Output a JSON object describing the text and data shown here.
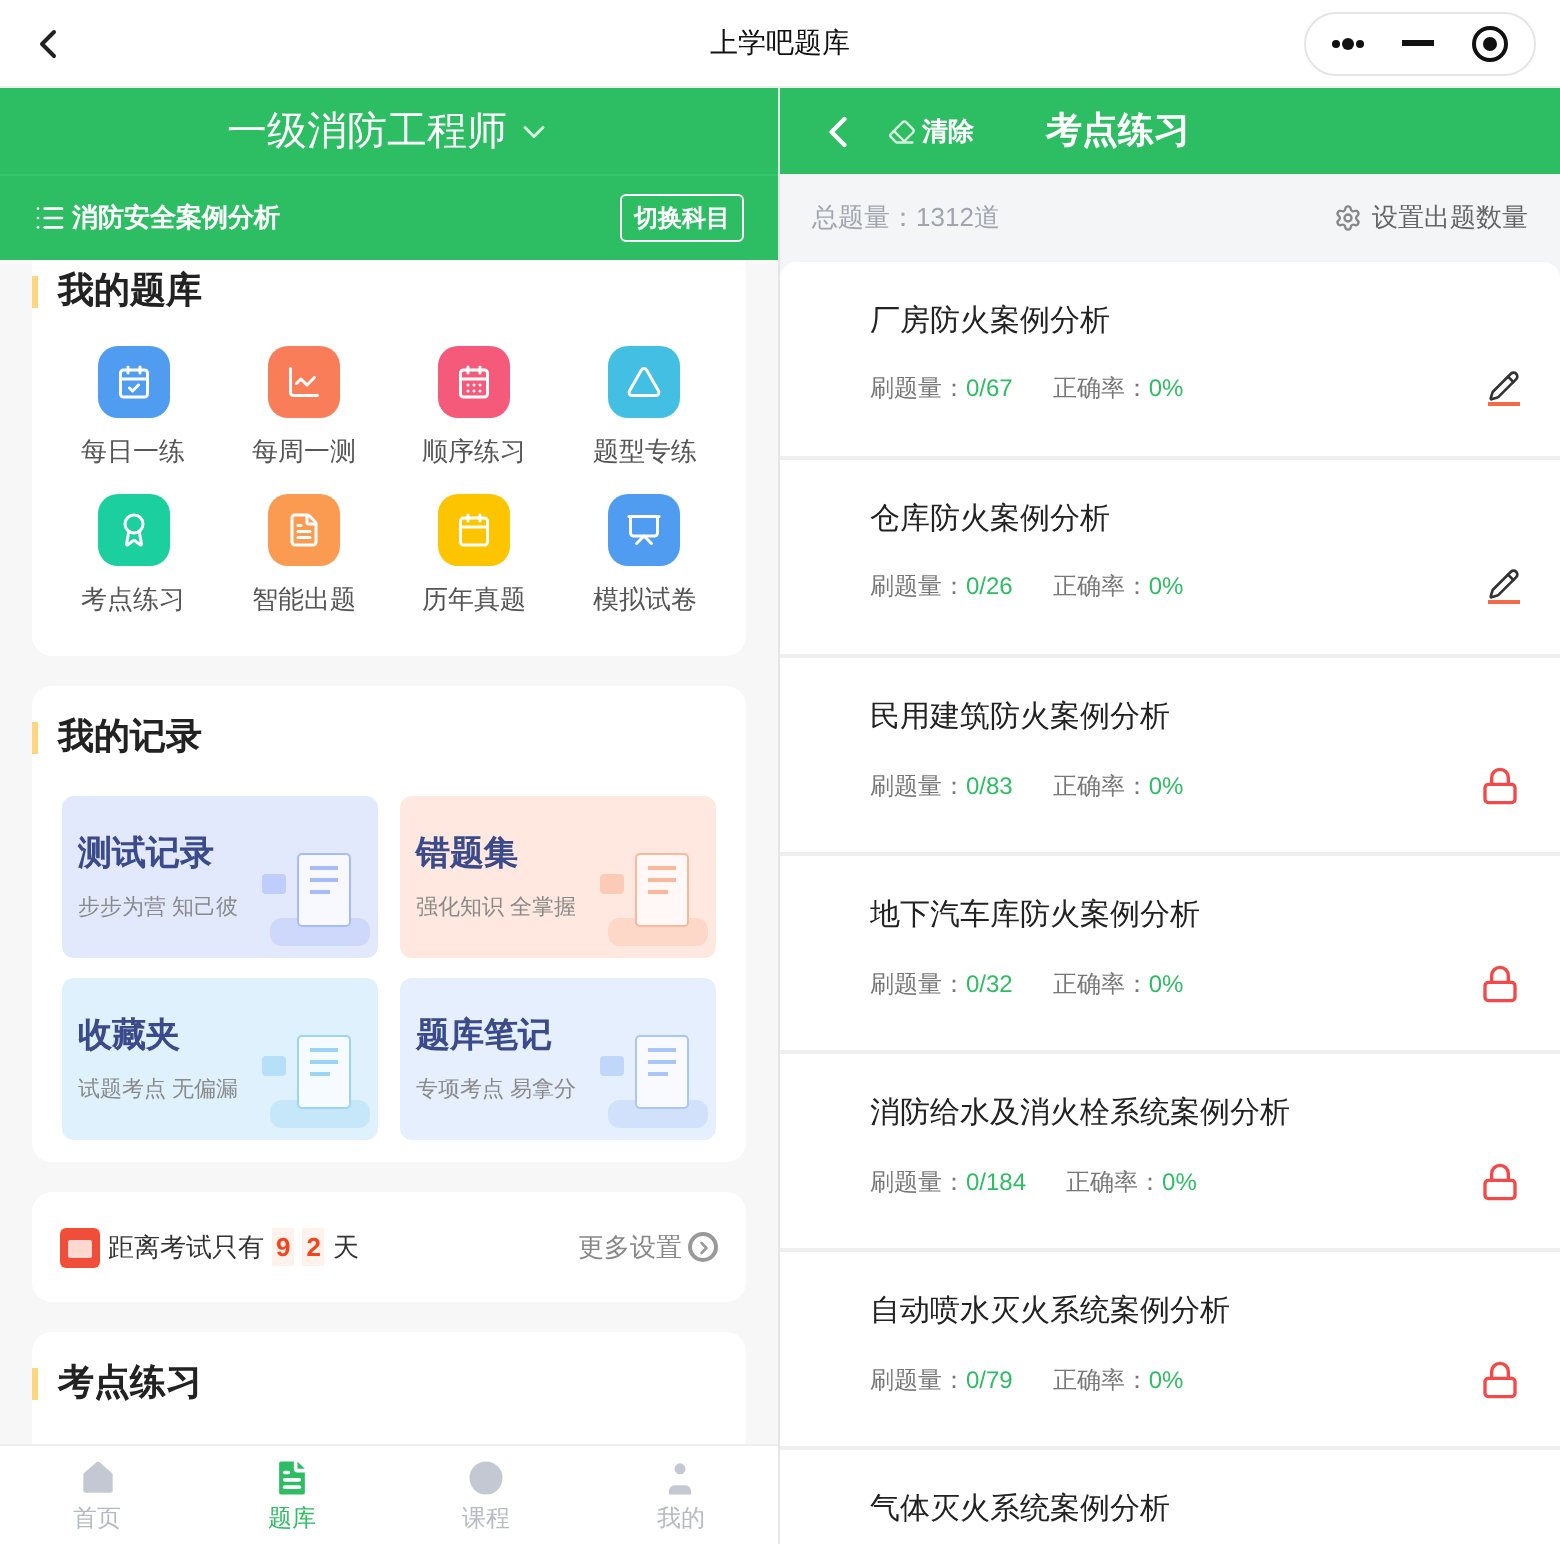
{
  "top_bar": {
    "title": "上学吧题库"
  },
  "left": {
    "exam_title": "一级消防工程师",
    "subject": "消防安全案例分析",
    "switch_button": "切换科目",
    "question_bank": {
      "title": "我的题库",
      "items": [
        {
          "label": "每日一练",
          "color": "#4f9cf0"
        },
        {
          "label": "每周一测",
          "color": "#fa7d5a"
        },
        {
          "label": "顺序练习",
          "color": "#f55a7a"
        },
        {
          "label": "题型专练",
          "color": "#43bfe3"
        },
        {
          "label": "考点练习",
          "color": "#1ccf9f"
        },
        {
          "label": "智能出题",
          "color": "#fb9b52"
        },
        {
          "label": "历年真题",
          "color": "#fdc400"
        },
        {
          "label": "模拟试卷",
          "color": "#4f9cf0"
        }
      ]
    },
    "records": {
      "title": "我的记录",
      "cards": [
        {
          "title": "测试记录",
          "subtitle": "步步为营 知己彼",
          "color": "#e3e9fd"
        },
        {
          "title": "错题集",
          "subtitle": "强化知识 全掌握",
          "color": "#ffe8e0"
        },
        {
          "title": "收藏夹",
          "subtitle": "试题考点 无偏漏",
          "color": "#dff1fd"
        },
        {
          "title": "题库笔记",
          "subtitle": "专项考点 易拿分",
          "color": "#e6effd"
        }
      ]
    },
    "countdown": {
      "prefix": "距离考试只有",
      "digits": [
        "9",
        "2"
      ],
      "suffix": "天",
      "more": "更多设置"
    },
    "practice": {
      "title": "考点练习"
    },
    "bottom_nav": [
      {
        "label": "首页",
        "selected": false
      },
      {
        "label": "题库",
        "selected": true
      },
      {
        "label": "课程",
        "selected": false
      },
      {
        "label": "我的",
        "selected": false
      }
    ]
  },
  "right": {
    "clear": "清除",
    "title": "考点练习",
    "total": "总题量：1312道",
    "settings": "设置出题数量",
    "topics": [
      {
        "name": "厂房防火案例分析",
        "done_label": "刷题量：",
        "done": "0/67",
        "accuracy_label": "正确率：",
        "accuracy": "0%",
        "locked": false
      },
      {
        "name": "仓库防火案例分析",
        "done_label": "刷题量：",
        "done": "0/26",
        "accuracy_label": "正确率：",
        "accuracy": "0%",
        "locked": false
      },
      {
        "name": "民用建筑防火案例分析",
        "done_label": "刷题量：",
        "done": "0/83",
        "accuracy_label": "正确率：",
        "accuracy": "0%",
        "locked": true
      },
      {
        "name": "地下汽车库防火案例分析",
        "done_label": "刷题量：",
        "done": "0/32",
        "accuracy_label": "正确率：",
        "accuracy": "0%",
        "locked": true
      },
      {
        "name": "消防给水及消火栓系统案例分析",
        "done_label": "刷题量：",
        "done": "0/184",
        "accuracy_label": "正确率：",
        "accuracy": "0%",
        "locked": true
      },
      {
        "name": "自动喷水灭火系统案例分析",
        "done_label": "刷题量：",
        "done": "0/79",
        "accuracy_label": "正确率：",
        "accuracy": "0%",
        "locked": true
      },
      {
        "name": "气体灭火系统案例分析"
      }
    ]
  }
}
